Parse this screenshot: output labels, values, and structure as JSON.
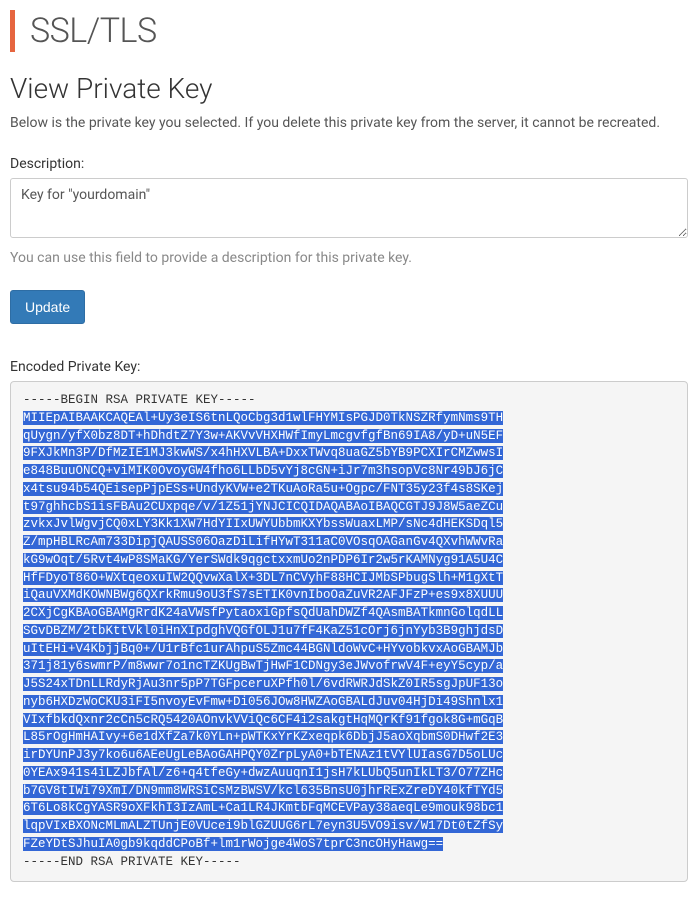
{
  "header": {
    "title": "SSL/TLS"
  },
  "page": {
    "heading": "View Private Key",
    "intro": "Below is the private key you selected. If you delete this private key from the server, it cannot be recreated."
  },
  "description": {
    "label": "Description:",
    "value": "Key for \"yourdomain\"",
    "help": "You can use this field to provide a description for this private key."
  },
  "actions": {
    "update": "Update"
  },
  "encoded": {
    "label": "Encoded Private Key:",
    "begin": "-----BEGIN RSA PRIVATE KEY-----",
    "lines": [
      "MIIEpAIBAAKCAQEAl+Uy3eIS6tnLQoCbg3d1wlFHYMIsPGJD0TkNSZRfymNms9TH",
      "qUygn/yfX0bz8DT+hDhdtZ7Y3w+AKVvVHXHWfImyLmcgvfgfBn69IA8/yD+uN5EF",
      "9FXJkMn3P/DfMzIE1MJ3kwWS/x4hHXVLBA+DxxTWvq8uaGZ5bYB9PCXIrCMZwwsI",
      "e848BuuONCQ+viMIK0OvoyGW4fho6LLbD5vYj8cGN+iJr7m3hsopVc8Nr49bJ6jC",
      "x4tsu94b54QEisepPjpESs+UndyKVW+e2TKuAoRa5u+Ogpc/FNT35y23f4s8SKej",
      "t97ghhcbS1isFBAu2CUxpqe/v/1Z51jYNJCICQIDAQABAoIBAQCGTJ9J8W5aeZCu",
      "zvkxJvlWgvjCQ0xLY3Kk1XW7HdYIIxUWYUbbmKXYbssWuaxLMP/sNc4dHEKSDql5",
      "Z/mpHBLRcAm733DipjQAUSS06OazDiLifHYwT311aC0VOsqOAGanGv4QXvhWWvRa",
      "kG9wOqt/5Rvt4wP8SMaKG/YerSWdk9qgctxxmUo2nPDP6Ir2w5rKAMNyg91A5U4C",
      "HfFDyoT86O+WXtqeoxuIW2QQvwXalX+3DL7nCVyhF88HCIJMbSPbugSlh+M1gXtT",
      "iQauVXMdKOWNBWg6QXrkRmu9oU3fS7sETIK0vnIboOaZuVR2AFJFzP+es9x8XUUU",
      "2CXjCgKBAoGBAMgRrdK24aVWsfPytaoxiGpfsQdUahDWZf4QAsmBATkmnGolqdLL",
      "SGvDBZM/2tbKttVkl0iHnXIpdghVQGfOLJ1u7fF4KaZ51cOrj6jnYyb3B9ghjdsD",
      "uItEHi+V4KbjjBq0+/U1rBfc1urAhpuS5Zmc44BGNldoWvC+HYvobkvxAoGBAMJb",
      "371j81y6swmrP/m8wwr7o1ncTZKUgBwTjHwF1CDNgy3eJWvofrwV4F+eyY5cyp/a",
      "J5S24xTDnLLRdyRjAu3nr5pP7TGFpceruXPfh0l/6vdRWRJdSkZ0IR5sgJpUF13o",
      "nyb6HXDzWoCKU3iFI5nvoyEvFmw+Di056JOw8HWZAoGBALdJuv04HjDi49Shnlx1",
      "VIxfbkdQxnr2cCn5cRQ5420AOnvkVViQc6CF4i2sakgtHqMQrKf91fgok8G+mGqB",
      "L85rOgHmHAIvy+6e1dXfZa7k0YLn+pWTKxYrKZxeqpk6DbjJ5aoXqbmS0DHwf2E3",
      "irDYUnPJ3y7ko6u6AEeUgLeBAoGAHPQY0ZrpLyA0+bTENAz1tVYlUIasG7D5oLUc",
      "0YEAx941s4iLZJbfAl/z6+q4tfeGy+dwzAuuqnI1jsH7kLUbQ5unIkLT3/O77ZHc",
      "b7GV8tIWi79XmI/DN9mm8WRSiCsMzBWSV/kcl635BnsU0jhrRExZreDY40kfTYd5",
      "6T6Lo8kCgYASR9oXFkhI3IzAmL+Ca1LR4JKmtbFqMCEVPay38aeqLe9mouk98bc1",
      "lqpVIxBXONcMLmALZTUnjE0VUcei9blGZUUG6rL7eyn3U5VO9isv/W17Dt0tZfSy",
      "FZeYDtSJhuIA0gb9kqddCPoBf+lm1rWojge4WoS7tprC3ncOHyHawg=="
    ],
    "end": "-----END RSA PRIVATE KEY-----"
  }
}
